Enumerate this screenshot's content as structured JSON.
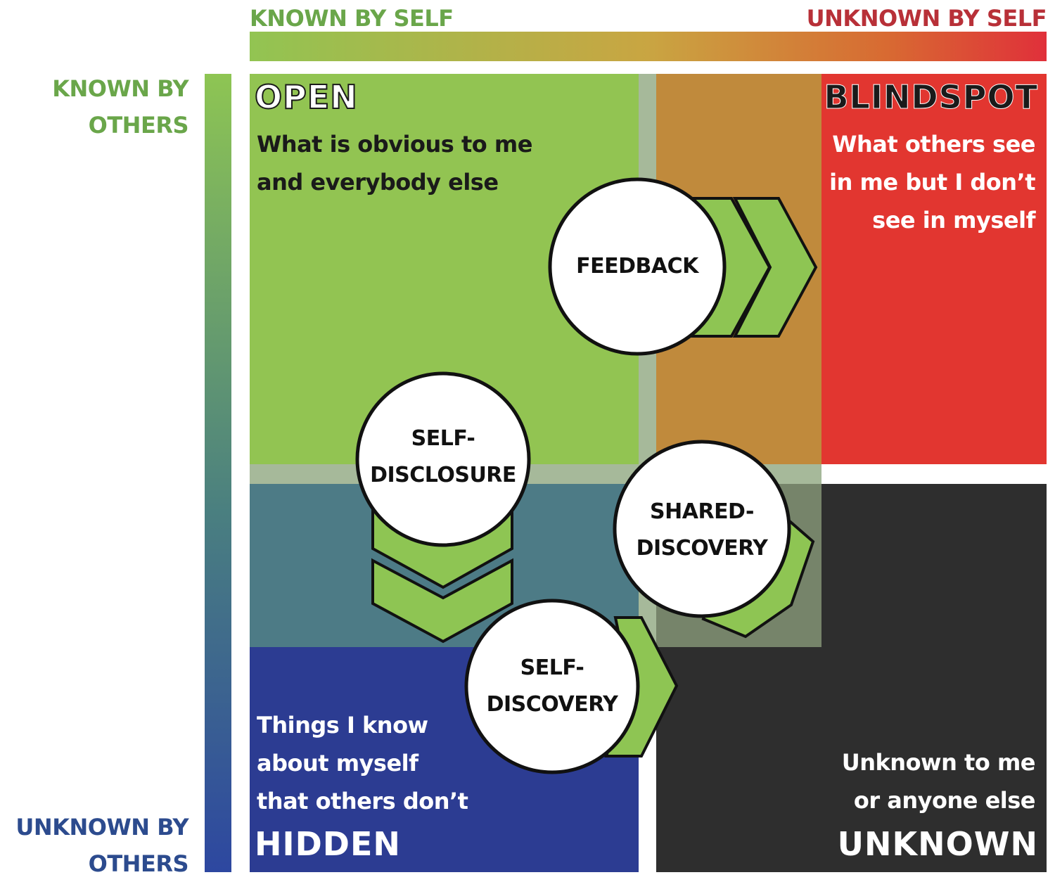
{
  "axes": {
    "top_left": "KNOWN BY SELF",
    "top_right": "UNKNOWN BY SELF",
    "left_top": [
      "KNOWN BY",
      "OTHERS"
    ],
    "left_bottom": [
      "UNKNOWN BY",
      "OTHERS"
    ]
  },
  "quadrants": {
    "open": {
      "title": "OPEN",
      "lines": [
        "What is obvious to me",
        "and everybody else"
      ]
    },
    "blindspot": {
      "title": "BLINDSPOT",
      "lines": [
        "What others see",
        "in me but I don’t",
        "see in myself"
      ]
    },
    "hidden": {
      "title": "HIDDEN",
      "lines": [
        "Things I know",
        "about myself",
        "that others don’t"
      ]
    },
    "unknown": {
      "title": "UNKNOWN",
      "lines": [
        "Unknown to me",
        "or anyone else"
      ]
    }
  },
  "processes": {
    "feedback": [
      "FEEDBACK"
    ],
    "self_disclosure": [
      "SELF-",
      "DISCLOSURE"
    ],
    "shared_discovery": [
      "SHARED-",
      "DISCOVERY"
    ],
    "self_discovery": [
      "SELF-",
      "DISCOVERY"
    ]
  },
  "colors": {
    "open": "#92c452",
    "blindspot": "#e23630",
    "hidden": "#2c3c92",
    "unknown": "#2e2e2e",
    "feedback_overlap": "#c08a3c",
    "disclosure_overlap": "#4d7b86",
    "chevron": "#8ec553"
  }
}
